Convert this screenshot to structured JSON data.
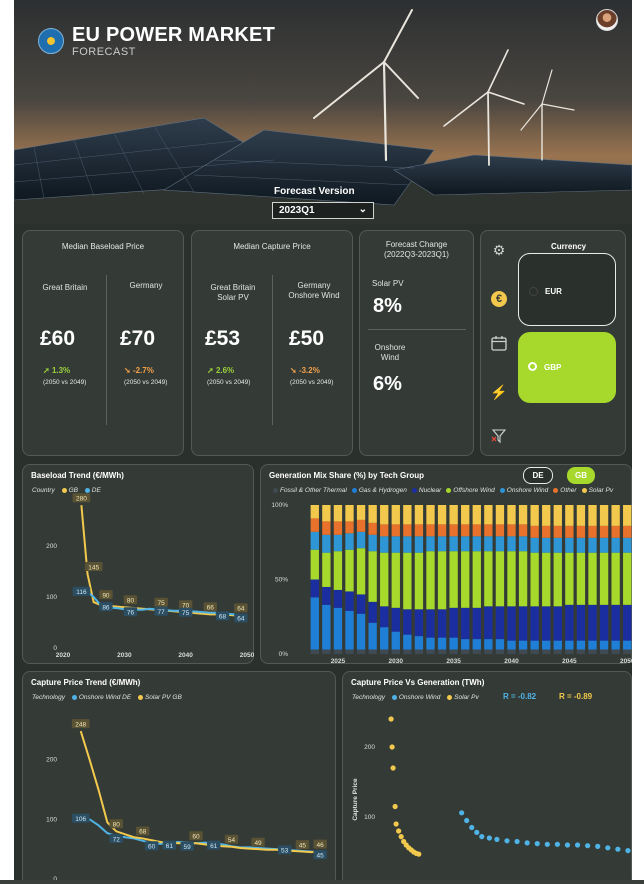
{
  "header": {
    "title": "EU POWER MARKET",
    "subtitle": "FORECAST",
    "forecast_version_label": "Forecast Version",
    "forecast_version_value": "2023Q1"
  },
  "baseload_card": {
    "title": "Median Baseload Price",
    "left": {
      "label": "Great Britain",
      "value": "£60",
      "change": "1.3%",
      "note": "(2050 vs 2049)"
    },
    "right": {
      "label": "Germany",
      "value": "£70",
      "change": "-2.7%",
      "note": "(2050 vs 2049)"
    }
  },
  "capture_card": {
    "title": "Median Capture Price",
    "left": {
      "label": "Great Britain\nSolar PV",
      "value": "£53",
      "change": "2.6%",
      "note": "(2050 vs 2049)"
    },
    "right": {
      "label": "Germany\nOnshore Wind",
      "value": "£50",
      "change": "-3.2%",
      "note": "(2050 vs 2049)"
    }
  },
  "forecast_change_card": {
    "title": "Forecast Change\n(2022Q3-2023Q1)",
    "solar_label": "Solar PV",
    "solar_value": "8%",
    "wind_label": "Onshore\nWind",
    "wind_value": "6%"
  },
  "currency": {
    "title": "Currency",
    "options": [
      "EUR",
      "GBP"
    ],
    "selected": "GBP"
  },
  "colors": {
    "accent": "#a6d92b",
    "gb": "#f2c94c",
    "de": "#4fb3e6"
  },
  "baseload_chart": {
    "title": "Baseload Trend (€/MWh)",
    "legend_label": "Country",
    "series_names": [
      "GB",
      "DE"
    ]
  },
  "genmix_chart": {
    "title": "Generation Mix Share (%) by Tech Group",
    "toggle": [
      "DE",
      "GB"
    ],
    "toggle_selected": "GB",
    "legend": [
      "Fossil & Other Thermal",
      "Gas & Hydrogen",
      "Nuclear",
      "Offshore Wind",
      "Onshore Wind",
      "Other",
      "Solar Pv"
    ]
  },
  "capture_trend_chart": {
    "title": "Capture Price Trend (€/MWh)",
    "legend_label": "Technology",
    "series_names": [
      "Onshore Wind DE",
      "Solar PV GB"
    ]
  },
  "scatter_chart": {
    "title": "Capture Price Vs Generation (TWh)",
    "legend_label": "Technology",
    "series_names": [
      "Onshore Wind",
      "Solar Pv"
    ],
    "r_wind": "R = -0.82",
    "r_solar": "R = -0.89",
    "ylabel": "Capture Price"
  },
  "chart_data": [
    {
      "type": "line",
      "title": "Baseload Trend (€/MWh)",
      "x": [
        2023,
        2024,
        2025,
        2026,
        2027,
        2028,
        2029,
        2030,
        2031,
        2032,
        2033,
        2034,
        2035,
        2036,
        2037,
        2038,
        2039,
        2040,
        2041,
        2042,
        2043,
        2044,
        2045,
        2046,
        2047,
        2048,
        2049,
        2050
      ],
      "xticks": [
        2020,
        2030,
        2040,
        2050
      ],
      "yticks": [
        0,
        100,
        200
      ],
      "ylim": [
        0,
        300
      ],
      "series": [
        {
          "name": "GB",
          "values": [
            280,
            145,
            90,
            85,
            83,
            82,
            81,
            80,
            79,
            78,
            77,
            76,
            75,
            74,
            73,
            72,
            71,
            70,
            69,
            68,
            67,
            66,
            66,
            65,
            65,
            64,
            64,
            64
          ]
        },
        {
          "name": "DE",
          "values": [
            116,
            110,
            100,
            86,
            82,
            79,
            78,
            76,
            76,
            75,
            75,
            77,
            76,
            75,
            74,
            73,
            73,
            75,
            72,
            71,
            70,
            69,
            69,
            68,
            67,
            66,
            65,
            64
          ]
        }
      ],
      "labels": [
        {
          "series": "GB",
          "x": 2023,
          "y": 280,
          "text": "280"
        },
        {
          "series": "GB",
          "x": 2025,
          "y": 145,
          "text": "145"
        },
        {
          "series": "GB",
          "x": 2027,
          "y": 90,
          "text": "90"
        },
        {
          "series": "GB",
          "x": 2031,
          "y": 80,
          "text": "80"
        },
        {
          "series": "GB",
          "x": 2036,
          "y": 75,
          "text": "75"
        },
        {
          "series": "GB",
          "x": 2040,
          "y": 70,
          "text": "70"
        },
        {
          "series": "GB",
          "x": 2044,
          "y": 66,
          "text": "66"
        },
        {
          "series": "GB",
          "x": 2049,
          "y": 64,
          "text": "64"
        },
        {
          "series": "DE",
          "x": 2023,
          "y": 116,
          "text": "116"
        },
        {
          "series": "DE",
          "x": 2027,
          "y": 86,
          "text": "86"
        },
        {
          "series": "DE",
          "x": 2031,
          "y": 76,
          "text": "76"
        },
        {
          "series": "DE",
          "x": 2036,
          "y": 77,
          "text": "77"
        },
        {
          "series": "DE",
          "x": 2040,
          "y": 75,
          "text": "75"
        },
        {
          "series": "DE",
          "x": 2046,
          "y": 68,
          "text": "68"
        },
        {
          "series": "DE",
          "x": 2049,
          "y": 64,
          "text": "64"
        }
      ]
    },
    {
      "type": "bar",
      "stacked": true,
      "title": "Generation Mix Share (%) by Tech Group",
      "x": [
        2023,
        2024,
        2025,
        2026,
        2027,
        2028,
        2029,
        2030,
        2031,
        2032,
        2033,
        2034,
        2035,
        2036,
        2037,
        2038,
        2039,
        2040,
        2041,
        2042,
        2043,
        2044,
        2045,
        2046,
        2047,
        2048,
        2049,
        2050
      ],
      "xticks": [
        2025,
        2030,
        2035,
        2040,
        2045,
        2050
      ],
      "yticks": [
        "0%",
        "50%",
        "100%"
      ],
      "series": [
        {
          "name": "Fossil & Other Thermal",
          "color": "#3f4a52",
          "values": [
            3,
            3,
            3,
            3,
            3,
            3,
            3,
            3,
            3,
            3,
            3,
            3,
            3,
            3,
            3,
            3,
            3,
            3,
            3,
            3,
            3,
            3,
            3,
            3,
            3,
            3,
            3,
            3
          ]
        },
        {
          "name": "Gas & Hydrogen",
          "color": "#1f7fd6",
          "values": [
            35,
            30,
            28,
            26,
            24,
            18,
            15,
            12,
            10,
            9,
            8,
            8,
            8,
            7,
            7,
            7,
            7,
            6,
            6,
            6,
            6,
            6,
            6,
            6,
            6,
            6,
            6,
            6
          ]
        },
        {
          "name": "Nuclear",
          "color": "#1a2ea0",
          "values": [
            12,
            12,
            12,
            13,
            13,
            14,
            14,
            16,
            17,
            18,
            19,
            19,
            20,
            21,
            21,
            22,
            22,
            23,
            23,
            23,
            23,
            23,
            24,
            24,
            24,
            24,
            24,
            24
          ]
        },
        {
          "name": "Offshore Wind",
          "color": "#a6d92b",
          "values": [
            20,
            23,
            26,
            28,
            31,
            34,
            36,
            37,
            38,
            38,
            39,
            39,
            38,
            38,
            38,
            37,
            37,
            37,
            37,
            36,
            36,
            36,
            35,
            35,
            35,
            35,
            35,
            35
          ]
        },
        {
          "name": "Onshore Wind",
          "color": "#2f96d6",
          "values": [
            12,
            12,
            11,
            11,
            11,
            11,
            11,
            11,
            11,
            11,
            10,
            10,
            10,
            10,
            10,
            10,
            10,
            10,
            10,
            10,
            10,
            10,
            10,
            10,
            10,
            10,
            10,
            10
          ]
        },
        {
          "name": "Other",
          "color": "#e8712b",
          "values": [
            9,
            9,
            9,
            8,
            8,
            8,
            8,
            8,
            8,
            8,
            8,
            8,
            8,
            8,
            8,
            8,
            8,
            8,
            8,
            8,
            8,
            8,
            8,
            8,
            8,
            8,
            8,
            8
          ]
        },
        {
          "name": "Solar Pv",
          "color": "#f2c94c",
          "values": [
            9,
            11,
            11,
            11,
            10,
            12,
            13,
            13,
            13,
            13,
            13,
            13,
            13,
            13,
            13,
            13,
            13,
            13,
            13,
            14,
            14,
            14,
            14,
            14,
            14,
            14,
            14,
            14
          ]
        }
      ]
    },
    {
      "type": "line",
      "title": "Capture Price Trend (€/MWh)",
      "x": [
        2023,
        2024,
        2025,
        2026,
        2027,
        2028,
        2029,
        2030,
        2031,
        2032,
        2033,
        2034,
        2035,
        2036,
        2037,
        2038,
        2039,
        2040,
        2041,
        2042,
        2043,
        2044,
        2045,
        2046,
        2047,
        2048,
        2049,
        2050
      ],
      "yticks": [
        0,
        100,
        200
      ],
      "ylim": [
        0,
        280
      ],
      "series": [
        {
          "name": "Onshore Wind DE",
          "values": [
            106,
            100,
            90,
            77,
            72,
            70,
            68,
            64,
            60,
            59,
            61,
            62,
            61,
            60,
            61,
            60,
            58,
            55,
            53,
            53,
            52,
            51,
            50,
            49,
            48,
            47,
            46,
            45
          ]
        },
        {
          "name": "Solar PV GB",
          "values": [
            248,
            200,
            150,
            95,
            80,
            75,
            70,
            68,
            65,
            62,
            61,
            60,
            60,
            60,
            58,
            56,
            55,
            54,
            52,
            51,
            50,
            49,
            49,
            48,
            47,
            46,
            45,
            46
          ]
        }
      ],
      "labels": [
        {
          "series": "Solar PV GB",
          "x": 2023,
          "y": 248,
          "text": "248"
        },
        {
          "series": "Onshore Wind DE",
          "x": 2023,
          "y": 106,
          "text": "106"
        },
        {
          "series": "Onshore Wind DE",
          "x": 2027,
          "y": 72,
          "text": "72"
        },
        {
          "series": "Solar PV GB",
          "x": 2030,
          "y": 68,
          "text": "68"
        },
        {
          "series": "Solar PV GB",
          "x": 2027,
          "y": 80,
          "text": "80"
        },
        {
          "series": "Onshore Wind DE",
          "x": 2031,
          "y": 60,
          "text": "60"
        },
        {
          "series": "Onshore Wind DE",
          "x": 2033,
          "y": 61,
          "text": "61"
        },
        {
          "series": "Onshore Wind DE",
          "x": 2035,
          "y": 59,
          "text": "59"
        },
        {
          "series": "Solar PV GB",
          "x": 2036,
          "y": 60,
          "text": "60"
        },
        {
          "series": "Onshore Wind DE",
          "x": 2038,
          "y": 61,
          "text": "61"
        },
        {
          "series": "Solar PV GB",
          "x": 2040,
          "y": 54,
          "text": "54"
        },
        {
          "series": "Solar PV GB",
          "x": 2043,
          "y": 49,
          "text": "49"
        },
        {
          "series": "Onshore Wind DE",
          "x": 2046,
          "y": 53,
          "text": "53"
        },
        {
          "series": "Solar PV GB",
          "x": 2048,
          "y": 45,
          "text": "45"
        },
        {
          "series": "Onshore Wind DE",
          "x": 2050,
          "y": 45,
          "text": "45"
        },
        {
          "series": "Solar PV GB",
          "x": 2050,
          "y": 46,
          "text": "46"
        }
      ]
    },
    {
      "type": "scatter",
      "title": "Capture Price Vs Generation (TWh)",
      "ylabel": "Capture Price",
      "yticks": [
        100,
        200
      ],
      "ylim": [
        0,
        250
      ],
      "xlim": [
        0,
        500
      ],
      "series": [
        {
          "name": "Solar Pv",
          "points": [
            [
              20,
              240
            ],
            [
              22,
              200
            ],
            [
              24,
              170
            ],
            [
              28,
              115
            ],
            [
              30,
              90
            ],
            [
              35,
              80
            ],
            [
              40,
              72
            ],
            [
              45,
              65
            ],
            [
              50,
              60
            ],
            [
              55,
              56
            ],
            [
              60,
              53
            ],
            [
              65,
              50
            ],
            [
              70,
              48
            ],
            [
              75,
              47
            ]
          ]
        },
        {
          "name": "Onshore Wind",
          "points": [
            [
              160,
              106
            ],
            [
              170,
              95
            ],
            [
              180,
              85
            ],
            [
              190,
              78
            ],
            [
              200,
              72
            ],
            [
              215,
              70
            ],
            [
              230,
              68
            ],
            [
              250,
              66
            ],
            [
              270,
              65
            ],
            [
              290,
              63
            ],
            [
              310,
              62
            ],
            [
              330,
              61
            ],
            [
              350,
              61
            ],
            [
              370,
              60
            ],
            [
              390,
              60
            ],
            [
              410,
              59
            ],
            [
              430,
              58
            ],
            [
              450,
              56
            ],
            [
              470,
              54
            ],
            [
              490,
              52
            ]
          ]
        }
      ]
    }
  ]
}
